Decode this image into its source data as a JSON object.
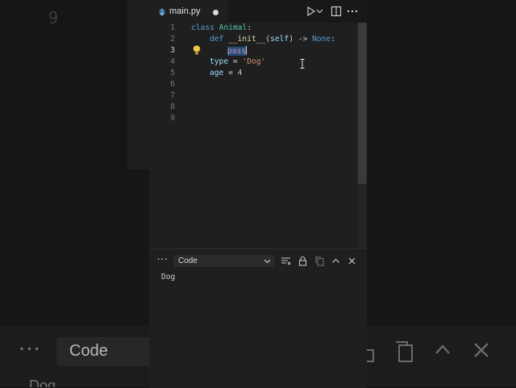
{
  "background": {
    "line_number": "9",
    "panel_select_label": "Code",
    "output_text": "Dog"
  },
  "editor": {
    "tab": {
      "filename": "main.py",
      "dirty": true
    },
    "toolbar_icons": [
      "run-icon",
      "chevron-down-icon",
      "split-editor-icon",
      "more-icon"
    ],
    "line_numbers": [
      "1",
      "2",
      "3",
      "4",
      "5",
      "6",
      "7",
      "8",
      "9"
    ],
    "active_line": "3",
    "lines": {
      "l1": {
        "kw": "class",
        "name": "Animal",
        "colon": ":"
      },
      "l2": {
        "kw": "def",
        "fn": "__init__",
        "open": "(",
        "param": "self",
        "close": ")",
        "arrow": " -> ",
        "ret": "None",
        "colon": ":"
      },
      "l3": {
        "kw": "pass"
      },
      "l4": {
        "var": "type",
        "eq": " = ",
        "str": "'Dog'"
      },
      "l5": {
        "var": "age",
        "eq": " = ",
        "num": "4"
      }
    }
  },
  "panel": {
    "more_label": "···",
    "select_value": "Code",
    "icons": [
      "clear-output-icon",
      "lock-icon",
      "copy-icon",
      "chevron-up-icon",
      "close-icon"
    ],
    "output": "Dog"
  },
  "colors": {
    "editor_bg": "#1f1f1f",
    "keyword": "#569cd6",
    "class_name": "#4ec9b0",
    "function": "#dcdcaa",
    "string": "#ce9178",
    "number": "#b5cea8",
    "selection": "#264f78",
    "bulb": "#f2c744"
  }
}
